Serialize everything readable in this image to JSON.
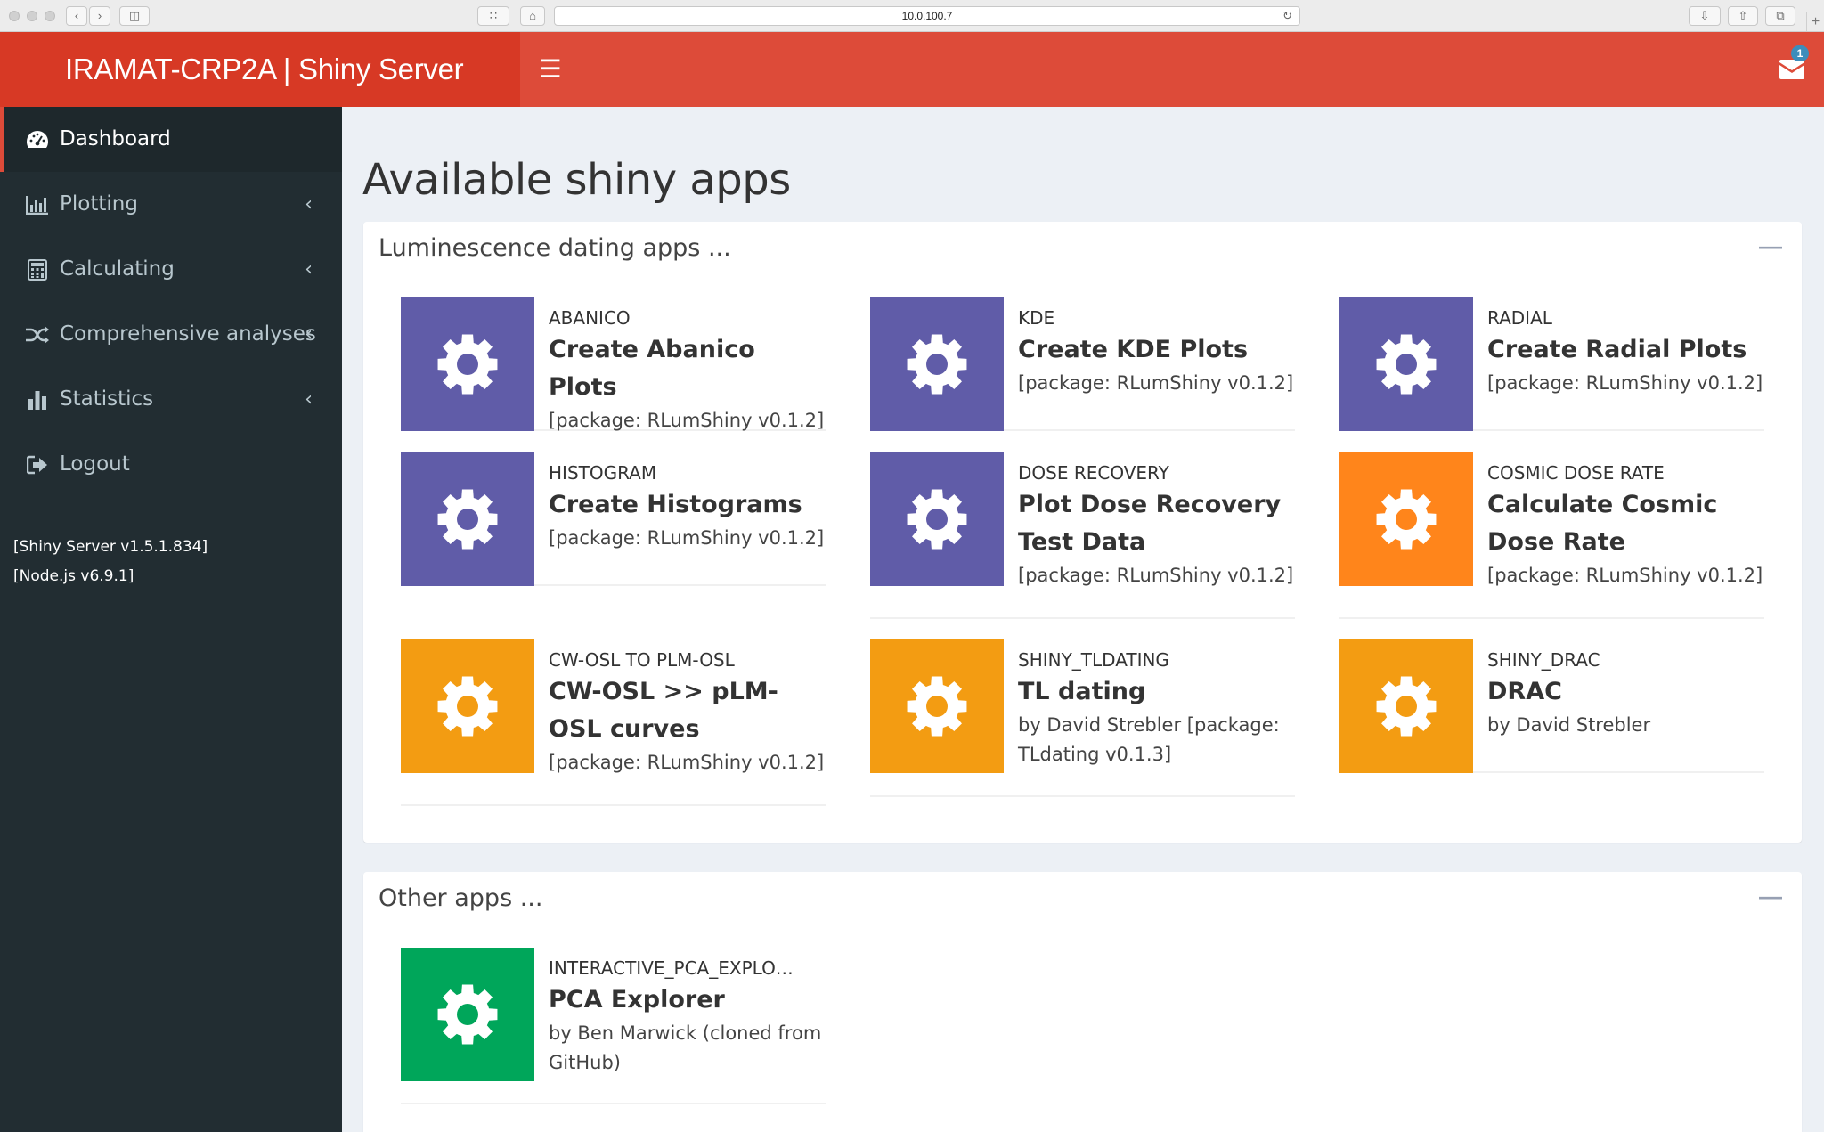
{
  "browser": {
    "url": "10.0.100.7"
  },
  "header": {
    "logo": "IRAMAT-CRP2A | Shiny Server",
    "mail_count": "1"
  },
  "sidebar": {
    "items": [
      {
        "label": "Dashboard",
        "icon": "dashboard-icon"
      },
      {
        "label": "Plotting",
        "icon": "bar-chart-icon"
      },
      {
        "label": "Calculating",
        "icon": "calculator-icon"
      },
      {
        "label": "Comprehensive analyses",
        "icon": "random-icon"
      },
      {
        "label": "Statistics",
        "icon": "stats-icon"
      },
      {
        "label": "Logout",
        "icon": "sign-out-icon"
      }
    ],
    "server_version": "[Shiny Server v1.5.1.834]",
    "node_version": "[Node.js v6.9.1]"
  },
  "main": {
    "title": "Available shiny apps",
    "luminescence_box": {
      "title": "Luminescence dating apps ...",
      "apps": [
        {
          "name": "ABANICO",
          "title": "Create Abanico Plots",
          "desc": "[package: RLumShiny v0.1.2]",
          "color": "#605ca8"
        },
        {
          "name": "KDE",
          "title": "Create KDE Plots",
          "desc": "[package: RLumShiny v0.1.2]",
          "color": "#605ca8"
        },
        {
          "name": "RADIAL",
          "title": "Create Radial Plots",
          "desc": "[package: RLumShiny v0.1.2]",
          "color": "#605ca8"
        },
        {
          "name": "HISTOGRAM",
          "title": "Create Histograms",
          "desc": "[package: RLumShiny v0.1.2]",
          "color": "#605ca8"
        },
        {
          "name": "DOSE RECOVERY",
          "title": "Plot Dose Recovery Test Data",
          "desc": "[package: RLumShiny v0.1.2]",
          "color": "#605ca8"
        },
        {
          "name": "COSMIC DOSE RATE",
          "title": "Calculate Cosmic Dose Rate",
          "desc": "[package: RLumShiny v0.1.2]",
          "color": "#ff851b"
        },
        {
          "name": "CW-OSL TO PLM-OSL",
          "title": "CW-OSL >> pLM-OSL curves",
          "desc": "[package: RLumShiny v0.1.2]",
          "color": "#f39c12"
        },
        {
          "name": "SHINY_TLDATING",
          "title": "TL dating",
          "desc": "by David Strebler [package: TLdating v0.1.3]",
          "color": "#f39c12"
        },
        {
          "name": "SHINY_DRAC",
          "title": "DRAC",
          "desc": "by David Strebler",
          "color": "#f39c12"
        }
      ]
    },
    "other_box": {
      "title": "Other apps ...",
      "apps": [
        {
          "name": "INTERACTIVE_PCA_EXPLO…",
          "title": "PCA Explorer",
          "desc": "by Ben Marwick (cloned from GitHub)",
          "color": "#00a65a"
        }
      ]
    }
  }
}
